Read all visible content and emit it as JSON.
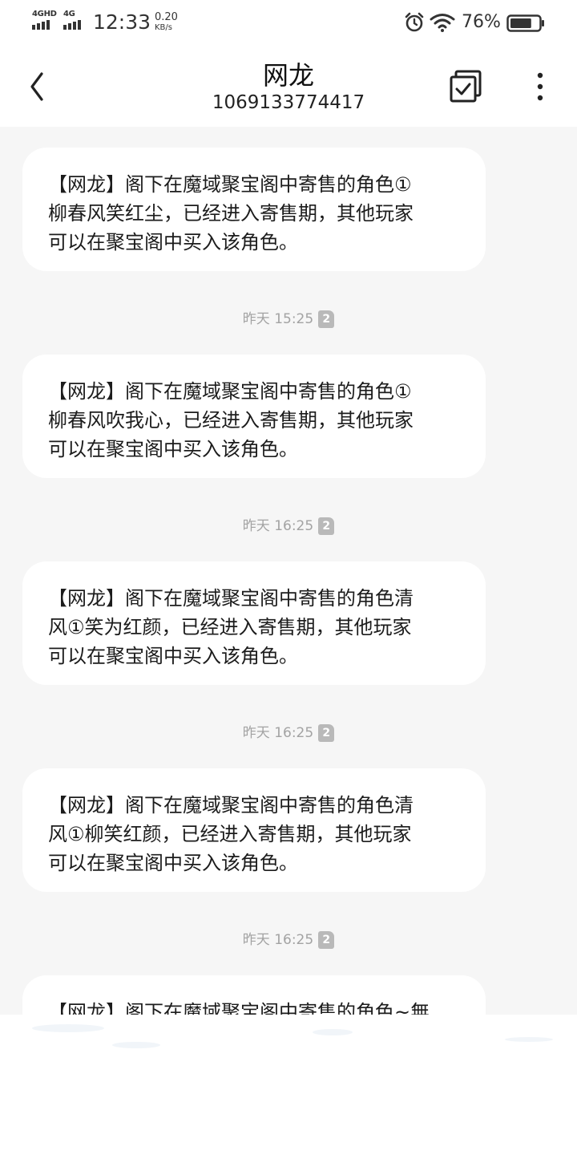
{
  "status_bar": {
    "network1_label": "4GHD",
    "network2_label": "4G",
    "time": "12:33",
    "net_speed": "0.20",
    "net_speed_unit": "KB/s",
    "battery_percent": "76%",
    "battery_level": 0.76
  },
  "header": {
    "title": "网龙",
    "phone_number": "1069133774417"
  },
  "messages": [
    {
      "text": "【网龙】阁下在魔域聚宝阁中寄售的角色①\n柳春风笑红尘，已经进入寄售期，其他玩家\n可以在聚宝阁中买入该角色。"
    },
    {
      "text": "【网龙】阁下在魔域聚宝阁中寄售的角色①\n柳春风吹我心，已经进入寄售期，其他玩家\n可以在聚宝阁中买入该角色。"
    },
    {
      "text": "【网龙】阁下在魔域聚宝阁中寄售的角色清\n风①笑为红颜，已经进入寄售期，其他玩家\n可以在聚宝阁中买入该角色。"
    },
    {
      "text": "【网龙】阁下在魔域聚宝阁中寄售的角色清\n风①柳笑红颜，已经进入寄售期，其他玩家\n可以在聚宝阁中买入该角色。"
    },
    {
      "text": "【网龙】阁下在魔域聚宝阁中寄售的角色~無"
    }
  ],
  "timestamps": [
    {
      "time": "昨天 15:25",
      "sim": "2"
    },
    {
      "time": "昨天 16:25",
      "sim": "2"
    },
    {
      "time": "昨天 16:25",
      "sim": "2"
    },
    {
      "time": "昨天 16:25",
      "sim": "2"
    }
  ],
  "icons": {
    "back": "chevron-left-icon",
    "multi_select": "checkbox-multi-icon",
    "more": "more-vertical-icon",
    "alarm": "alarm-icon",
    "wifi": "wifi-icon",
    "battery": "battery-icon"
  }
}
